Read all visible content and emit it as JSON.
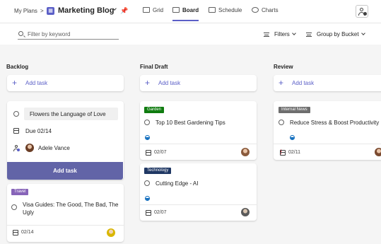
{
  "header": {
    "breadcrumb": "My Plans",
    "breadcrumb_sep": ">",
    "plan_icon": "plan-icon",
    "plan_title": "Marketing Blog",
    "tabs": [
      {
        "label": "Grid",
        "icon": "grid-icon"
      },
      {
        "label": "Board",
        "icon": "board-icon",
        "active": true
      },
      {
        "label": "Schedule",
        "icon": "schedule-icon"
      },
      {
        "label": "Charts",
        "icon": "charts-icon"
      }
    ],
    "accent_color": "#5b5fc7"
  },
  "toolbar": {
    "search_placeholder": "Filter by keyword",
    "filters_label": "Filters",
    "group_label": "Group by Bucket"
  },
  "buckets": [
    {
      "title": "Backlog",
      "add_task_label": "Add task",
      "new_task_form": {
        "title_value": "Flowers the Language of Love",
        "due_label": "Due 02/14",
        "assignee": "Adele Vance",
        "submit_label": "Add task"
      },
      "cards": [
        {
          "tag": "Travel",
          "tag_color": "#8764b8",
          "title": "Visa Guides: The Good, The Bad, The Ugly",
          "date": "02/14"
        }
      ]
    },
    {
      "title": "Final Draft",
      "add_task_label": "Add task",
      "cards": [
        {
          "tag": "Garden",
          "tag_color": "#107c10",
          "title": "Top 10 Best Gardening Tips",
          "date": "02/07"
        },
        {
          "tag": "Technology",
          "tag_color": "#203864",
          "title": "Cutting Edge - AI",
          "date": "02/07"
        }
      ]
    },
    {
      "title": "Review",
      "add_task_label": "Add task",
      "cards": [
        {
          "tag": "Internal News",
          "tag_color": "#6e6e6e",
          "title": "Reduce Stress & Boost Productivity",
          "date": "02/11",
          "priority": "!"
        }
      ]
    }
  ]
}
